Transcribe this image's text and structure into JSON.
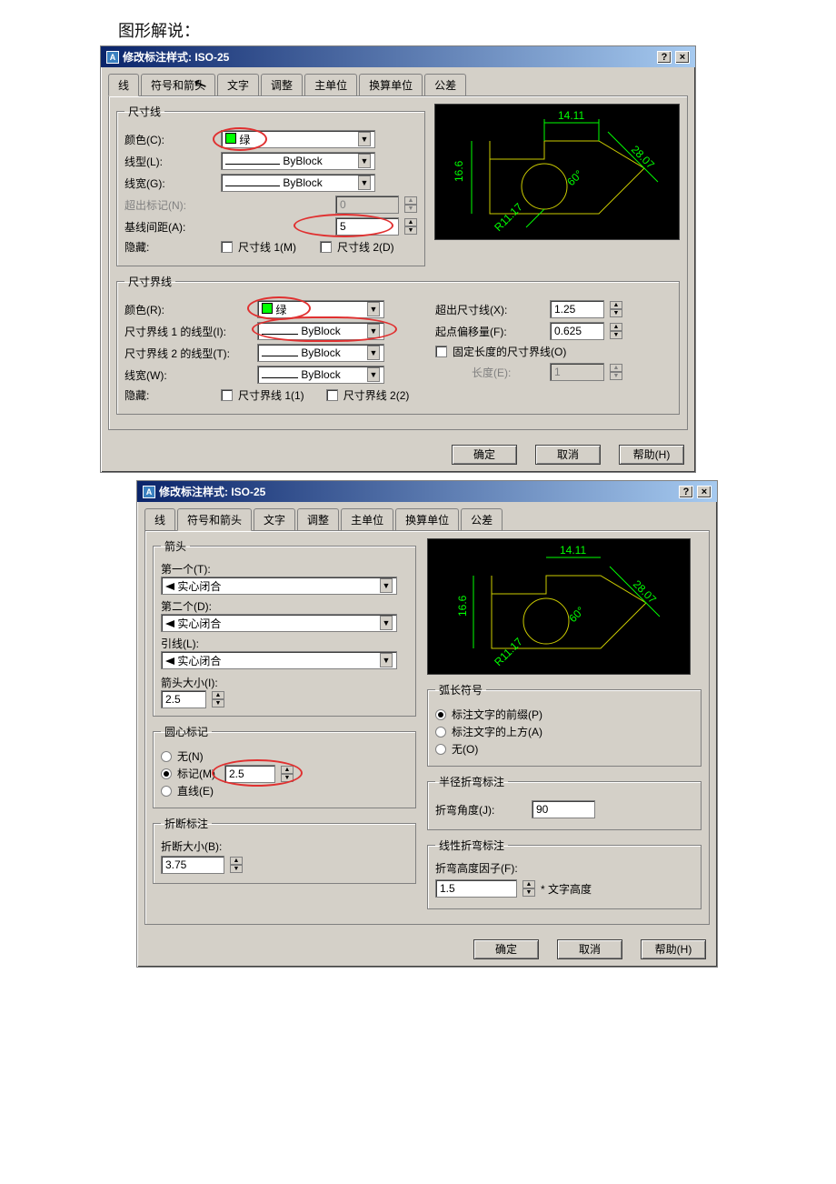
{
  "page_header": "图形解说：",
  "dialog1": {
    "title": "修改标注样式: ISO-25",
    "tabs": [
      "线",
      "符号和箭头",
      "文字",
      "调整",
      "主单位",
      "换算单位",
      "公差"
    ],
    "active_tab": 0,
    "dimline": {
      "legend": "尺寸线",
      "color_label": "颜色(C):",
      "color_value": "绿",
      "linetype_label": "线型(L):",
      "linetype_value": "ByBlock",
      "lineweight_label": "线宽(G):",
      "lineweight_value": "ByBlock",
      "extend_label": "超出标记(N):",
      "extend_value": "0",
      "baseline_label": "基线间距(A):",
      "baseline_value": "5",
      "hide_label": "隐藏:",
      "hide1": "尺寸线 1(M)",
      "hide2": "尺寸线 2(D)"
    },
    "extline": {
      "legend": "尺寸界线",
      "color_label": "颜色(R):",
      "color_value": "绿",
      "ext1type_label": "尺寸界线 1 的线型(I):",
      "ext1type_value": "ByBlock",
      "ext2type_label": "尺寸界线 2 的线型(T):",
      "ext2type_value": "ByBlock",
      "lineweight_label": "线宽(W):",
      "lineweight_value": "ByBlock",
      "hide_label": "隐藏:",
      "hide1": "尺寸界线 1(1)",
      "hide2": "尺寸界线 2(2)",
      "beyond_label": "超出尺寸线(X):",
      "beyond_value": "1.25",
      "offset_label": "起点偏移量(F):",
      "offset_value": "0.625",
      "fixed_label": "固定长度的尺寸界线(O)",
      "length_label": "长度(E):",
      "length_value": "1"
    },
    "buttons": {
      "ok": "确定",
      "cancel": "取消",
      "help": "帮助(H)"
    }
  },
  "dialog2": {
    "title": "修改标注样式: ISO-25",
    "tabs": [
      "线",
      "符号和箭头",
      "文字",
      "调整",
      "主单位",
      "换算单位",
      "公差"
    ],
    "active_tab": 1,
    "arrows": {
      "legend": "箭头",
      "first_label": "第一个(T):",
      "first_value": "实心闭合",
      "second_label": "第二个(D):",
      "second_value": "实心闭合",
      "leader_label": "引线(L):",
      "leader_value": "实心闭合",
      "size_label": "箭头大小(I):",
      "size_value": "2.5"
    },
    "centermark": {
      "legend": "圆心标记",
      "none": "无(N)",
      "mark": "标记(M)",
      "line": "直线(E)",
      "size_value": "2.5"
    },
    "dimbreak": {
      "legend": "折断标注",
      "size_label": "折断大小(B):",
      "size_value": "3.75"
    },
    "arcsym": {
      "legend": "弧长符号",
      "before": "标注文字的前缀(P)",
      "above": "标注文字的上方(A)",
      "none": "无(O)"
    },
    "jogradius": {
      "legend": "半径折弯标注",
      "angle_label": "折弯角度(J):",
      "angle_value": "90"
    },
    "joglinear": {
      "legend": "线性折弯标注",
      "factor_label": "折弯高度因子(F):",
      "factor_value": "1.5",
      "suffix": "* 文字高度"
    },
    "buttons": {
      "ok": "确定",
      "cancel": "取消",
      "help": "帮助(H)"
    }
  },
  "preview_dims": {
    "top": "14.11",
    "left": "16.6",
    "diag": "28.07",
    "angle": "60°",
    "radius": "R11.17"
  }
}
